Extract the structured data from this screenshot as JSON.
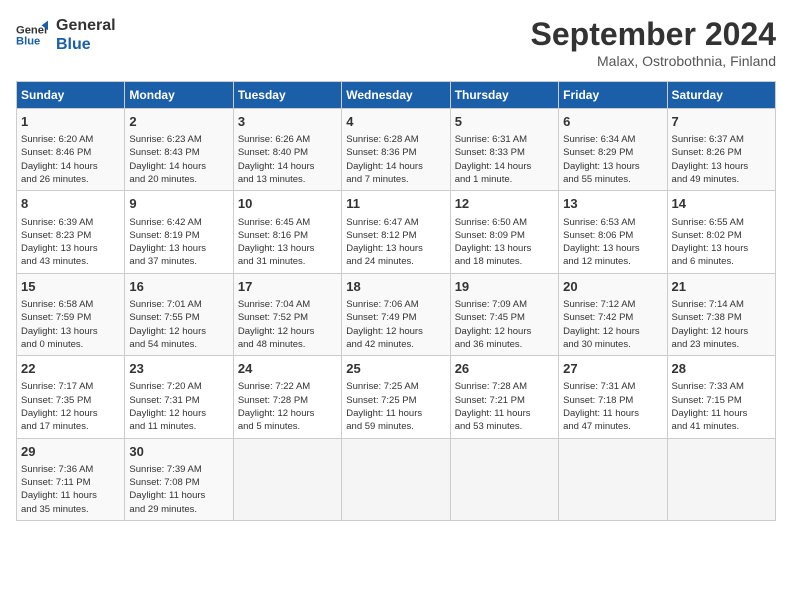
{
  "header": {
    "logo_general": "General",
    "logo_blue": "Blue",
    "title": "September 2024",
    "subtitle": "Malax, Ostrobothnia, Finland"
  },
  "columns": [
    "Sunday",
    "Monday",
    "Tuesday",
    "Wednesday",
    "Thursday",
    "Friday",
    "Saturday"
  ],
  "weeks": [
    [
      {
        "day": "1",
        "info": "Sunrise: 6:20 AM\nSunset: 8:46 PM\nDaylight: 14 hours\nand 26 minutes."
      },
      {
        "day": "2",
        "info": "Sunrise: 6:23 AM\nSunset: 8:43 PM\nDaylight: 14 hours\nand 20 minutes."
      },
      {
        "day": "3",
        "info": "Sunrise: 6:26 AM\nSunset: 8:40 PM\nDaylight: 14 hours\nand 13 minutes."
      },
      {
        "day": "4",
        "info": "Sunrise: 6:28 AM\nSunset: 8:36 PM\nDaylight: 14 hours\nand 7 minutes."
      },
      {
        "day": "5",
        "info": "Sunrise: 6:31 AM\nSunset: 8:33 PM\nDaylight: 14 hours\nand 1 minute."
      },
      {
        "day": "6",
        "info": "Sunrise: 6:34 AM\nSunset: 8:29 PM\nDaylight: 13 hours\nand 55 minutes."
      },
      {
        "day": "7",
        "info": "Sunrise: 6:37 AM\nSunset: 8:26 PM\nDaylight: 13 hours\nand 49 minutes."
      }
    ],
    [
      {
        "day": "8",
        "info": "Sunrise: 6:39 AM\nSunset: 8:23 PM\nDaylight: 13 hours\nand 43 minutes."
      },
      {
        "day": "9",
        "info": "Sunrise: 6:42 AM\nSunset: 8:19 PM\nDaylight: 13 hours\nand 37 minutes."
      },
      {
        "day": "10",
        "info": "Sunrise: 6:45 AM\nSunset: 8:16 PM\nDaylight: 13 hours\nand 31 minutes."
      },
      {
        "day": "11",
        "info": "Sunrise: 6:47 AM\nSunset: 8:12 PM\nDaylight: 13 hours\nand 24 minutes."
      },
      {
        "day": "12",
        "info": "Sunrise: 6:50 AM\nSunset: 8:09 PM\nDaylight: 13 hours\nand 18 minutes."
      },
      {
        "day": "13",
        "info": "Sunrise: 6:53 AM\nSunset: 8:06 PM\nDaylight: 13 hours\nand 12 minutes."
      },
      {
        "day": "14",
        "info": "Sunrise: 6:55 AM\nSunset: 8:02 PM\nDaylight: 13 hours\nand 6 minutes."
      }
    ],
    [
      {
        "day": "15",
        "info": "Sunrise: 6:58 AM\nSunset: 7:59 PM\nDaylight: 13 hours\nand 0 minutes."
      },
      {
        "day": "16",
        "info": "Sunrise: 7:01 AM\nSunset: 7:55 PM\nDaylight: 12 hours\nand 54 minutes."
      },
      {
        "day": "17",
        "info": "Sunrise: 7:04 AM\nSunset: 7:52 PM\nDaylight: 12 hours\nand 48 minutes."
      },
      {
        "day": "18",
        "info": "Sunrise: 7:06 AM\nSunset: 7:49 PM\nDaylight: 12 hours\nand 42 minutes."
      },
      {
        "day": "19",
        "info": "Sunrise: 7:09 AM\nSunset: 7:45 PM\nDaylight: 12 hours\nand 36 minutes."
      },
      {
        "day": "20",
        "info": "Sunrise: 7:12 AM\nSunset: 7:42 PM\nDaylight: 12 hours\nand 30 minutes."
      },
      {
        "day": "21",
        "info": "Sunrise: 7:14 AM\nSunset: 7:38 PM\nDaylight: 12 hours\nand 23 minutes."
      }
    ],
    [
      {
        "day": "22",
        "info": "Sunrise: 7:17 AM\nSunset: 7:35 PM\nDaylight: 12 hours\nand 17 minutes."
      },
      {
        "day": "23",
        "info": "Sunrise: 7:20 AM\nSunset: 7:31 PM\nDaylight: 12 hours\nand 11 minutes."
      },
      {
        "day": "24",
        "info": "Sunrise: 7:22 AM\nSunset: 7:28 PM\nDaylight: 12 hours\nand 5 minutes."
      },
      {
        "day": "25",
        "info": "Sunrise: 7:25 AM\nSunset: 7:25 PM\nDaylight: 11 hours\nand 59 minutes."
      },
      {
        "day": "26",
        "info": "Sunrise: 7:28 AM\nSunset: 7:21 PM\nDaylight: 11 hours\nand 53 minutes."
      },
      {
        "day": "27",
        "info": "Sunrise: 7:31 AM\nSunset: 7:18 PM\nDaylight: 11 hours\nand 47 minutes."
      },
      {
        "day": "28",
        "info": "Sunrise: 7:33 AM\nSunset: 7:15 PM\nDaylight: 11 hours\nand 41 minutes."
      }
    ],
    [
      {
        "day": "29",
        "info": "Sunrise: 7:36 AM\nSunset: 7:11 PM\nDaylight: 11 hours\nand 35 minutes."
      },
      {
        "day": "30",
        "info": "Sunrise: 7:39 AM\nSunset: 7:08 PM\nDaylight: 11 hours\nand 29 minutes."
      },
      {
        "day": "",
        "info": ""
      },
      {
        "day": "",
        "info": ""
      },
      {
        "day": "",
        "info": ""
      },
      {
        "day": "",
        "info": ""
      },
      {
        "day": "",
        "info": ""
      }
    ]
  ]
}
